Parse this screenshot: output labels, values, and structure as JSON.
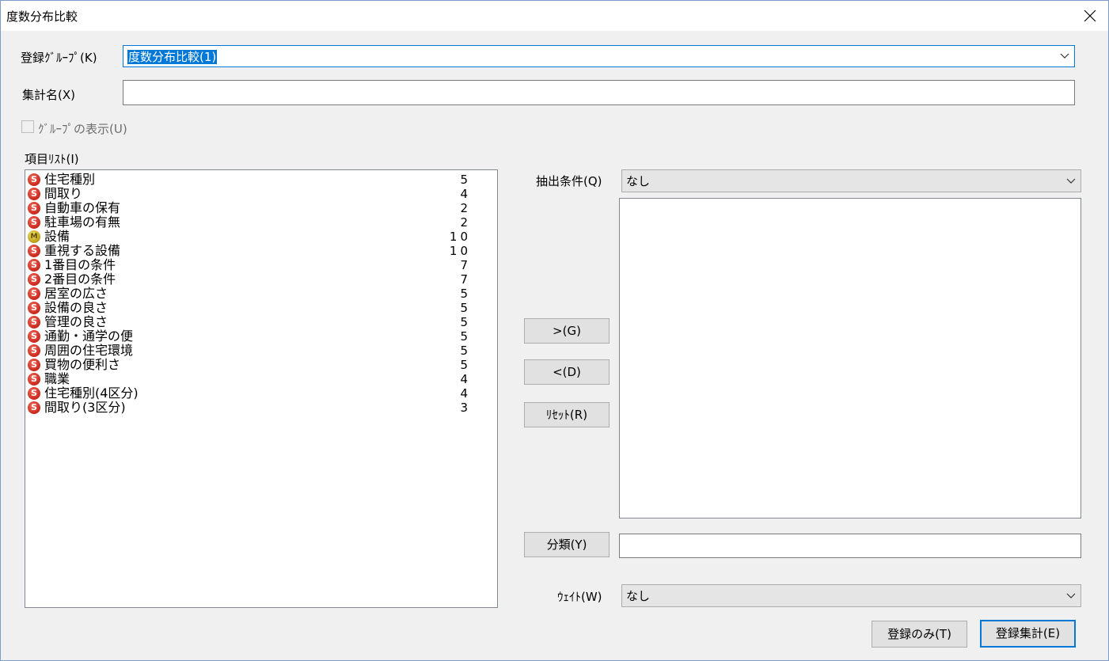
{
  "window": {
    "title": "度数分布比較",
    "close_icon": "close-icon"
  },
  "group": {
    "label": "登録ｸﾞﾙｰﾌﾟ(K)",
    "value": "度数分布比較(1)"
  },
  "total_name": {
    "label": "集計名(X)",
    "value": ""
  },
  "show_group": {
    "label": "ｸﾞﾙｰﾌﾟの表示(U)",
    "checked": false
  },
  "item_list": {
    "label": "項目ﾘｽﾄ(I)",
    "items": [
      {
        "icon": "S",
        "name": "住宅種別",
        "count": "5"
      },
      {
        "icon": "S",
        "name": "間取り",
        "count": "4"
      },
      {
        "icon": "S",
        "name": "自動車の保有",
        "count": "2"
      },
      {
        "icon": "S",
        "name": "駐車場の有無",
        "count": "2"
      },
      {
        "icon": "M",
        "name": "設備",
        "count": "10"
      },
      {
        "icon": "S",
        "name": "重視する設備",
        "count": "10"
      },
      {
        "icon": "S",
        "name": "1番目の条件",
        "count": "7"
      },
      {
        "icon": "S",
        "name": "2番目の条件",
        "count": "7"
      },
      {
        "icon": "S",
        "name": "居室の広さ",
        "count": "5"
      },
      {
        "icon": "S",
        "name": "設備の良さ",
        "count": "5"
      },
      {
        "icon": "S",
        "name": "管理の良さ",
        "count": "5"
      },
      {
        "icon": "S",
        "name": "通勤・通学の便",
        "count": "5"
      },
      {
        "icon": "S",
        "name": "周囲の住宅環境",
        "count": "5"
      },
      {
        "icon": "S",
        "name": "買物の便利さ",
        "count": "5"
      },
      {
        "icon": "S",
        "name": "職業",
        "count": "4"
      },
      {
        "icon": "S",
        "name": "住宅種別(4区分)",
        "count": "4"
      },
      {
        "icon": "S",
        "name": "間取り(3区分)",
        "count": "3"
      }
    ]
  },
  "buttons": {
    "add": ">(G)",
    "remove": "<(D)",
    "reset": "ﾘｾｯﾄ(R)",
    "classify": "分類(Y)",
    "register_only": "登録のみ(T)",
    "register_total": "登録集計(E)"
  },
  "extract": {
    "label": "抽出条件(Q)",
    "value": "なし"
  },
  "classify_field": {
    "value": ""
  },
  "weight": {
    "label": "ｳｪｲﾄ(W)",
    "value": "なし"
  },
  "colors": {
    "accent": "#0078d7",
    "icon_s": "#d0301f",
    "icon_m": "#c9a815"
  }
}
